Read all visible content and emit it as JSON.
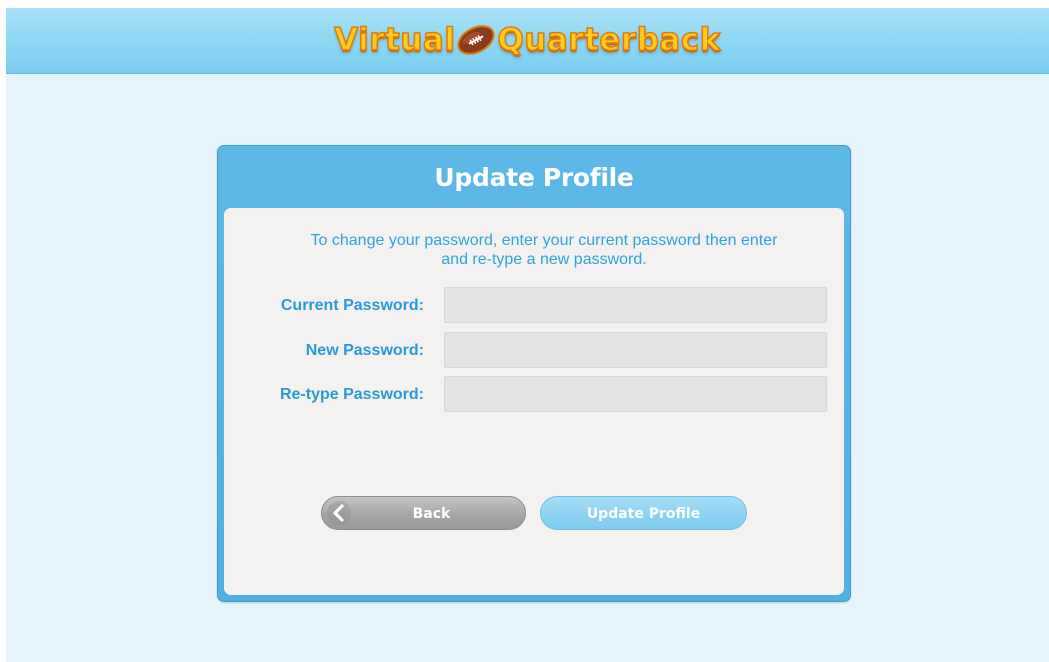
{
  "header": {
    "logo_word1": "Virtual",
    "logo_word2": "Quarterback",
    "logo_icon": "football-icon"
  },
  "card": {
    "title": "Update Profile",
    "intro_line1": "To change your password, enter your current password then enter",
    "intro_line2": "and re-type a new password."
  },
  "form": {
    "current_password_label": "Current Password:",
    "current_password_value": "",
    "new_password_label": "New Password:",
    "new_password_value": "",
    "retype_password_label": "Re-type Password:",
    "retype_password_value": ""
  },
  "buttons": {
    "back_label": "Back",
    "back_icon": "chevron-left-icon",
    "update_label": "Update Profile"
  },
  "colors": {
    "header_blue": "#8dd6f3",
    "card_blue": "#4fb0e1",
    "label_blue": "#2a9ad6",
    "logo_yellow": "#ffcc1f",
    "page_bg": "#e6f4fc"
  }
}
